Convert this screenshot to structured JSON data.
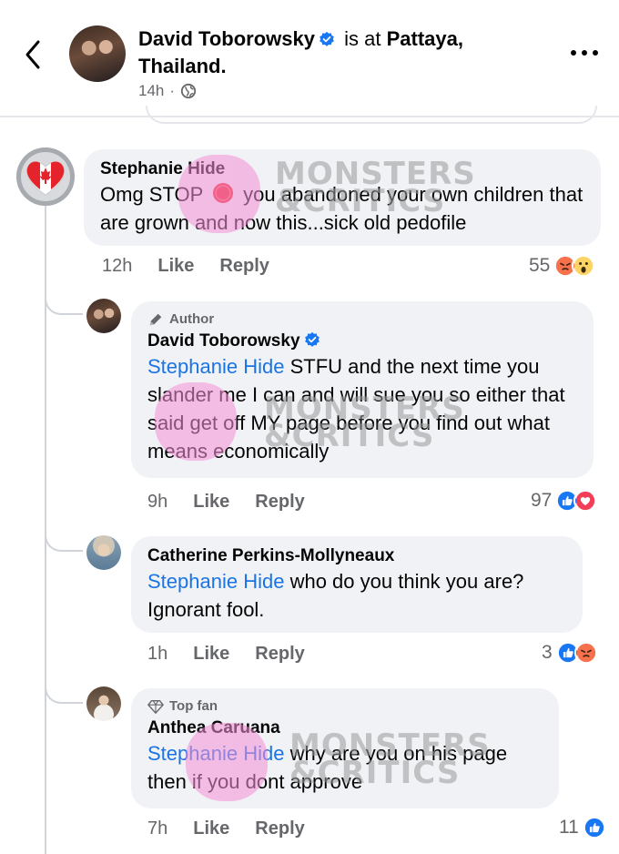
{
  "header": {
    "author": "David Toborowsky",
    "connector": "is at",
    "place": "Pattaya, Thailand.",
    "time": "14h",
    "separator": "·"
  },
  "watermark": {
    "line1": "MONSTERS",
    "line2": "&CRITICS"
  },
  "comments": [
    {
      "name": "Stephanie Hide",
      "text_before_emoji": "Omg STOP",
      "text_after_emoji": "you abandoned your own children that are grown and now this...sick old pedofile",
      "time": "12h",
      "like": "Like",
      "reply": "Reply",
      "reaction_count": "55",
      "reactions": [
        "angry",
        "wow"
      ]
    },
    {
      "badge": "Author",
      "name": "David Toborowsky",
      "mention": "Stephanie Hide",
      "text": "STFU and the next time you slander me I can and will sue you so either that said get off MY page before you find out what means economically",
      "time": "9h",
      "like": "Like",
      "reply": "Reply",
      "reaction_count": "97",
      "reactions": [
        "like",
        "love"
      ]
    },
    {
      "name": "Catherine Perkins-Mollyneaux",
      "mention": "Stephanie Hide",
      "text": "who do you think  you are? Ignorant fool.",
      "time": "1h",
      "like": "Like",
      "reply": "Reply",
      "reaction_count": "3",
      "reactions": [
        "like",
        "angry"
      ]
    },
    {
      "badge": "Top fan",
      "name": "Anthea Caruana",
      "mention": "Stephanie Hide",
      "text": "why are you on his page then if you dont approve",
      "time": "7h",
      "like": "Like",
      "reply": "Reply",
      "reaction_count": "11",
      "reactions": [
        "like"
      ]
    }
  ],
  "colors": {
    "mention": "#1b74e4",
    "bubble": "#f0f2f5",
    "secondary_text": "#65676b",
    "verified": "#1877f2",
    "like": "#1877f2",
    "love": "#f33e58",
    "angry": "#f7714c"
  }
}
